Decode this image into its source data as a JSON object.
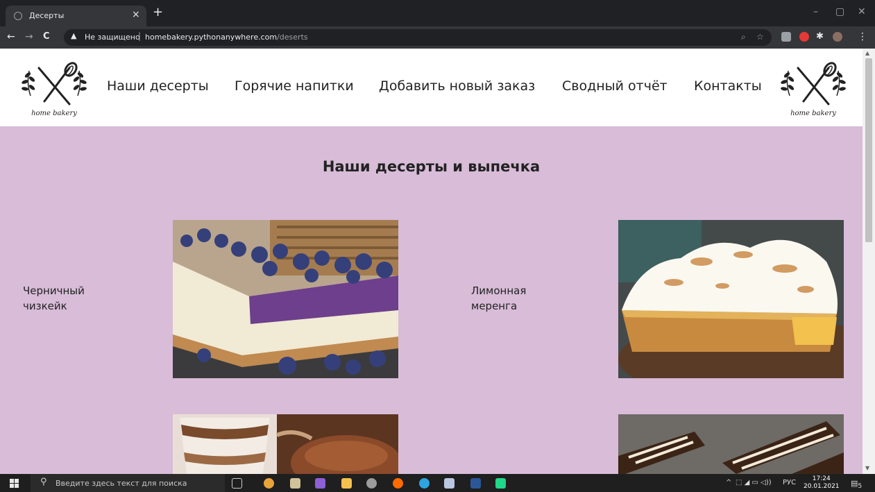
{
  "browser": {
    "tab_title": "Десерты",
    "tab_close": "×",
    "new_tab": "+",
    "window_controls": [
      "–",
      "▢",
      "✕"
    ],
    "back": "←",
    "forward": "→",
    "reload": "C",
    "warning_symbol": "▲",
    "insecure_label": "Не защищено",
    "separator": "|",
    "url_host": "homebakery.pythonanywhere.com",
    "url_path": "/deserts"
  },
  "site": {
    "logo_text": "home bakery",
    "nav": [
      "Наши десерты",
      "Горячие напитки",
      "Добавить новый заказ",
      "Сводный отчёт",
      "Контакты"
    ],
    "page_title": "Наши десерты и выпечка",
    "items": [
      {
        "name": "Черничный чизкейк",
        "image": "blueberry-cheesecake"
      },
      {
        "name": "Лимонная меренга",
        "image": "lemon-meringue-pie"
      },
      {
        "name": "",
        "image": "tiramisu-cups"
      },
      {
        "name": "",
        "image": "chocolate-eclairs"
      }
    ]
  },
  "taskbar": {
    "search_placeholder": "Введите здесь текст для поиска",
    "search_glyph": "⚲",
    "tray_chevron": "^",
    "language": "РУС",
    "time": "17:24",
    "date": "20.01.2021",
    "notifications": "5"
  }
}
